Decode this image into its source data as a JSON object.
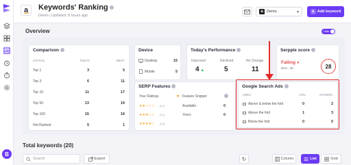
{
  "header": {
    "title": "Keywords' Ranking",
    "subtitle": "Demo | Updated: 8 hours ago",
    "store_select": "Demo",
    "add_keyword_label": "Add keyword"
  },
  "sidebar": {
    "avatar_initial": "B"
  },
  "overview": {
    "title": "Overview",
    "toggle_label": "Hide"
  },
  "comparison": {
    "title": "Comparison",
    "headers": [
      "STATUS",
      "TODAY",
      "BEST"
    ],
    "rows": [
      {
        "status": "Top 1",
        "today": "3",
        "best": "5"
      },
      {
        "status": "Top 3",
        "today": "6",
        "best": "11"
      },
      {
        "status": "Top 10",
        "today": "11",
        "best": "17"
      },
      {
        "status": "Top 50",
        "today": "13",
        "best": "19"
      },
      {
        "status": "Top 100",
        "today": "15",
        "best": "19"
      },
      {
        "status": "Not Ranked",
        "today": "5",
        "best": "1"
      }
    ]
  },
  "device": {
    "title": "Device",
    "rows": [
      {
        "label": "Desktop",
        "value": "15"
      },
      {
        "label": "Mobile",
        "value": "5"
      }
    ]
  },
  "performance": {
    "title": "Today's Performance",
    "improved_label": "Improved",
    "improved_value": "4",
    "declined_label": "Declined",
    "declined_value": "5",
    "nochange_label": "No Change",
    "nochange_value": "11"
  },
  "serpple": {
    "title": "Serpple score",
    "status": "Falling",
    "best_label": "Best : 38",
    "score": "28"
  },
  "serp": {
    "title": "SERP Features",
    "ratings_label": "Your Ratings",
    "featured_label": "Feature Snippet",
    "rows": [
      {
        "stars": "★★☆☆☆",
        "range": "(0-1)",
        "label": "Available",
        "value": "0"
      },
      {
        "stars": "★★★☆☆",
        "range": "(2-4)",
        "label": "Yours",
        "value": "0"
      },
      {
        "stars": "★★★★☆",
        "range": "(4-5)",
        "label": "",
        "value": ""
      }
    ]
  },
  "ads": {
    "title": "Google Search Ads",
    "headers": [
      "AREA",
      "YOU",
      "OTHERS"
    ],
    "rows": [
      {
        "area": "Above & below the fold",
        "you": "0",
        "others": "2"
      },
      {
        "area": "Above the fold",
        "you": "1",
        "others": "3"
      },
      {
        "area": "Below the fold",
        "you": "0",
        "others": "0"
      }
    ]
  },
  "keywords": {
    "title": "Total keywords (20)",
    "search_placeholder": "Search",
    "export_label": "Export",
    "column_label": "Column",
    "list_label": "List",
    "grid_label": "Grid"
  },
  "colors": {
    "accent": "#6c3bf4",
    "improved": "#2db96a",
    "declined": "#e5484d",
    "highlight": "#e22a2a"
  }
}
